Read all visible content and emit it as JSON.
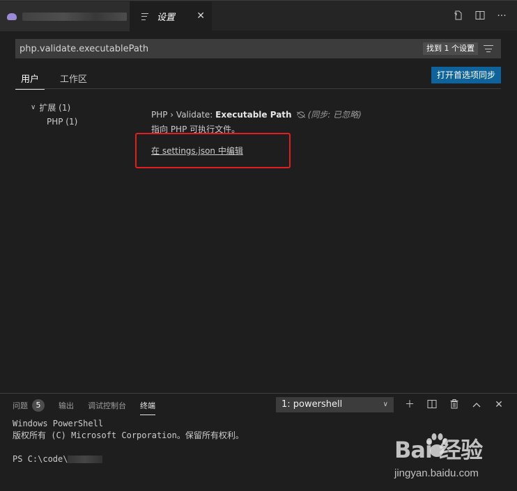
{
  "tabs": {
    "inactive_icon": "elephant-icon",
    "active_label": "设置",
    "close_glyph": "✕"
  },
  "tab_actions": [
    "open-json-icon",
    "split-editor-icon",
    "more-icon"
  ],
  "search": {
    "value": "php.validate.executablePath",
    "result_badge": "找到 1 个设置"
  },
  "scopes": {
    "user": "用户",
    "workspace": "工作区"
  },
  "sync_button": "打开首选项同步",
  "tree": {
    "extensions": "扩展 (1)",
    "php": "PHP (1)"
  },
  "setting": {
    "prefix": "PHP › Validate: ",
    "name": "Executable Path",
    "ignored": "(同步: 已忽略)",
    "description": "指向 PHP 可执行文件。",
    "edit_link": "在 settings.json 中编辑"
  },
  "panel": {
    "problems": "问题",
    "problems_count": "5",
    "output": "输出",
    "debug_console": "调试控制台",
    "terminal": "终端",
    "terminal_select": "1: powershell"
  },
  "terminal": {
    "line1": "Windows PowerShell",
    "line2": "版权所有 (C) Microsoft Corporation。保留所有权利。",
    "prompt": "PS C:\\code\\"
  },
  "watermark": {
    "logo": "Bai  经验",
    "url": "jingyan.baidu.com"
  },
  "colors": {
    "accent_button": "#0e639c",
    "highlight_box": "#e02020",
    "background": "#1e1e1e"
  }
}
